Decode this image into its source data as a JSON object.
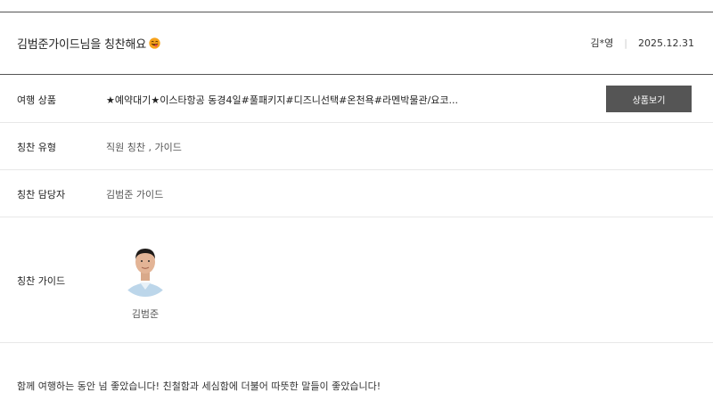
{
  "header": {
    "title": "김범준가이드님을 칭찬해요",
    "emoji_icon": "yummy-face-icon",
    "author": "김*영",
    "date": "2025.12.31"
  },
  "rows": {
    "product": {
      "label": "여행 상품",
      "value": "★예약대기★이스타항공 동경4일#풀패키지#디즈니선택#온천욕#라멘박물관/요코...",
      "button_label": "상품보기"
    },
    "praise_type": {
      "label": "칭찬 유형",
      "value": "직원 칭찬 , 가이드"
    },
    "praise_manager": {
      "label": "칭찬 담당자",
      "value": "김범준 가이드"
    },
    "praise_guide": {
      "label": "칭찬 가이드",
      "guide_name": "김범준",
      "photo_icon": "guide-photo"
    }
  },
  "message": "함께 여행하는 동안 넘 좋았습니다! 친철함과 세심함에 더불어 따뜻한 말들이 좋았습니다!",
  "colors": {
    "button_bg": "#555555",
    "divider_dark": "#555555",
    "divider_light": "#e8e8e8"
  }
}
